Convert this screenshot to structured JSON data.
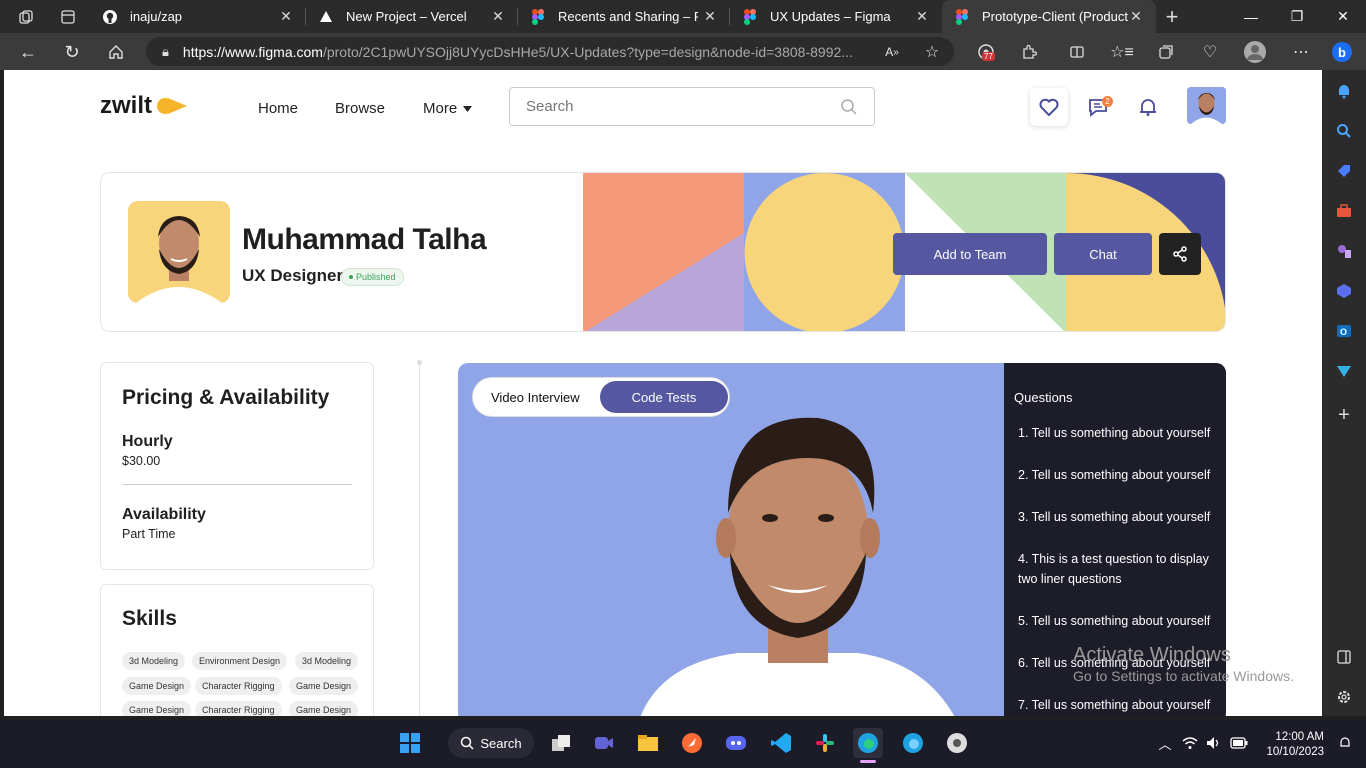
{
  "browser": {
    "tabs": [
      {
        "title": "inaju/zap",
        "icon": "github-icon"
      },
      {
        "title": "New Project – Vercel",
        "icon": "vercel-icon"
      },
      {
        "title": "Recents and Sharing – Figma",
        "icon": "figma-icon"
      },
      {
        "title": "UX Updates – Figma",
        "icon": "figma-icon"
      },
      {
        "title": "Prototype-Client (Product",
        "icon": "figma-icon"
      }
    ],
    "url_domain": "https://www.figma.com",
    "url_path": "/proto/2C1pwUYSOjj8UYycDsHHe5/UX-Updates?type=design&node-id=3808-8992...",
    "extension_badge": "77"
  },
  "site": {
    "logo": "zwilt",
    "nav": {
      "home": "Home",
      "browse": "Browse",
      "more": "More"
    },
    "search_placeholder": "Search",
    "messages_badge": "2"
  },
  "profile": {
    "name": "Muhammad Talha",
    "role": "UX Designer",
    "status": "Published",
    "add_to_team": "Add to Team",
    "chat": "Chat"
  },
  "pricing": {
    "title": "Pricing & Availability",
    "rate_label": "Hourly",
    "rate_value": "$30.00",
    "availability_label": "Availability",
    "availability_value": "Part Time"
  },
  "skills": {
    "title": "Skills",
    "rows": [
      [
        "3d Modeling",
        "Environment Design",
        "3d Modeling"
      ],
      [
        "Game Design",
        "Character Rigging",
        "Game Design"
      ],
      [
        "Game Design",
        "Character Rigging",
        "Game Design"
      ]
    ]
  },
  "interview": {
    "tab_video": "Video Interview",
    "tab_code": "Code Tests",
    "questions_title": "Questions",
    "questions": [
      "1. Tell us something about yourself",
      "2. Tell us something about yourself",
      "3. Tell us something about yourself",
      "4. This is a test question to display two liner questions",
      "5. Tell us something about yourself",
      "6. Tell us something about yourself",
      "7. Tell us something about yourself"
    ]
  },
  "watermark": {
    "line1": "Activate Windows",
    "line2": "Go to Settings to activate Windows."
  },
  "taskbar": {
    "search": "Search",
    "time": "12:00 AM",
    "date": "10/10/2023"
  },
  "colors": {
    "accent": "#5557a0",
    "video_bg": "#8fa5e8",
    "question_bg": "#1c1d29",
    "logo_arrow": "#f6b42a"
  }
}
